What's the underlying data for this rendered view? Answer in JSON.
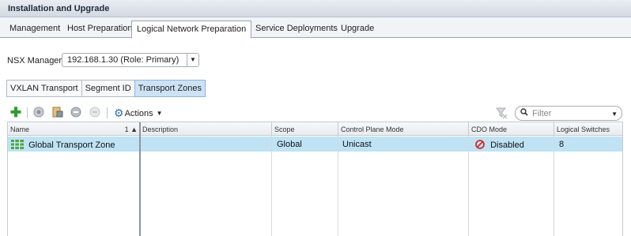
{
  "window": {
    "title": "Installation and Upgrade"
  },
  "tabs": [
    {
      "label": "Management"
    },
    {
      "label": "Host Preparation"
    },
    {
      "label": "Logical Network Preparation",
      "active": true
    },
    {
      "label": "Service Deployments"
    },
    {
      "label": "Upgrade"
    }
  ],
  "nsx_manager": {
    "label": "NSX Manager:",
    "value": "192.168.1.30 (Role: Primary)"
  },
  "subtabs": [
    {
      "label": "VXLAN Transport"
    },
    {
      "label": "Segment ID"
    },
    {
      "label": "Transport Zones",
      "active": true
    }
  ],
  "toolbar": {
    "actions_label": "Actions",
    "filter_placeholder": "Filter",
    "icons": [
      "add-icon",
      "connect-icon",
      "properties-icon",
      "disconnect-icon",
      "remove-icon",
      "actions-gear-icon",
      "clear-filter-icon",
      "search-icon"
    ],
    "accent": "#2e9b2e"
  },
  "grid": {
    "columns": [
      {
        "label": "Name",
        "sort": "1 ▲"
      },
      {
        "label": "Description"
      },
      {
        "label": "Scope"
      },
      {
        "label": "Control Plane Mode"
      },
      {
        "label": "CDO Mode"
      },
      {
        "label": "Logical Switches"
      }
    ],
    "rows": [
      {
        "name": "Global Transport Zone",
        "description": "",
        "scope": "Global",
        "control_plane_mode": "Unicast",
        "cdo_mode": "Disabled",
        "logical_switches": "8"
      }
    ],
    "selected_row_color": "#bfe3f4"
  }
}
